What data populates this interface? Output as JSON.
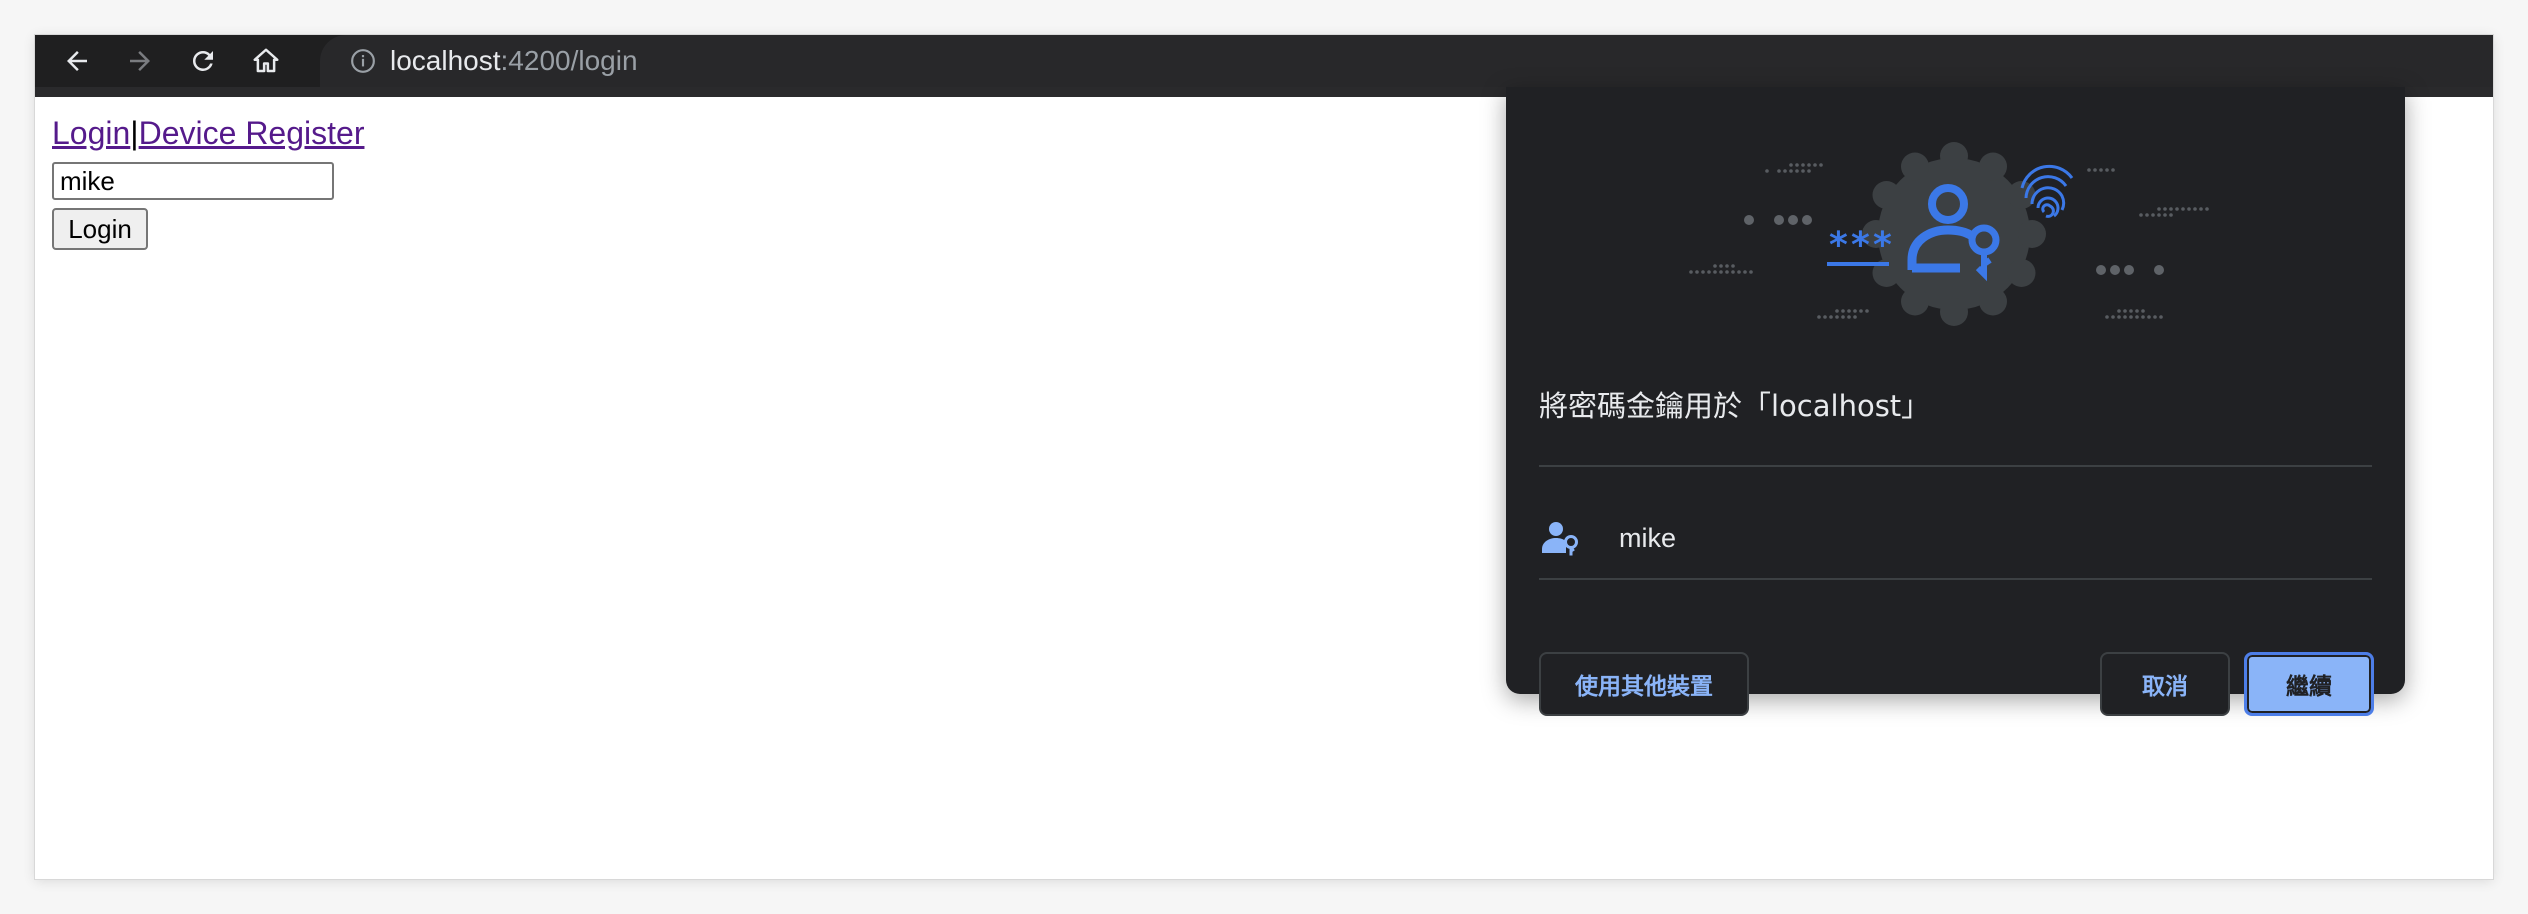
{
  "browser": {
    "url_host": "localhost",
    "url_rest": ":4200/login",
    "icons": [
      "back-icon",
      "forward-icon",
      "reload-icon",
      "home-icon",
      "info-icon"
    ]
  },
  "page": {
    "nav": {
      "login_link": "Login",
      "separator": "|",
      "device_register_link": "Device Register"
    },
    "username_value": "mike",
    "login_button": "Login"
  },
  "dialog": {
    "title": "將密碼金鑰用於「localhost」",
    "account_name": "mike",
    "other_device_button": "使用其他裝置",
    "cancel_button": "取消",
    "continue_button": "繼續",
    "colors": {
      "background": "#202124",
      "accent": "#8ab4f8",
      "illustration_blue": "#3b78e7"
    }
  }
}
